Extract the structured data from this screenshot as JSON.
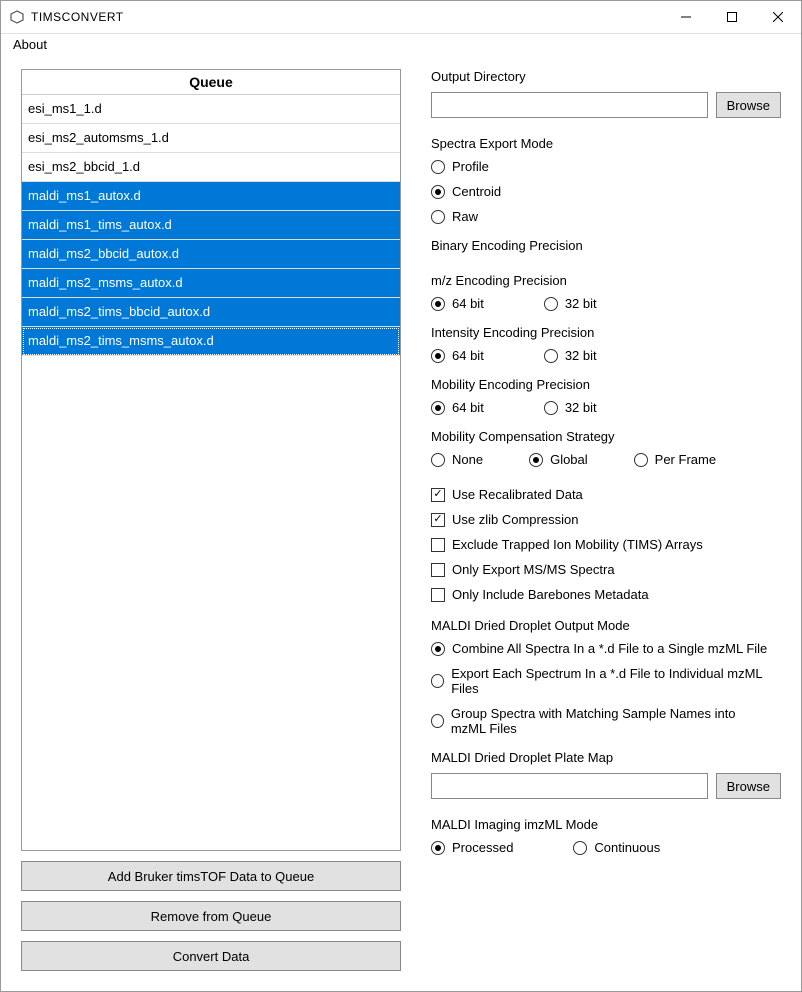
{
  "window": {
    "title": "TIMSCONVERT"
  },
  "menu": {
    "about": "About"
  },
  "queue": {
    "header": "Queue",
    "items": [
      {
        "label": "esi_ms1_1.d",
        "selected": false
      },
      {
        "label": "esi_ms2_automsms_1.d",
        "selected": false
      },
      {
        "label": "esi_ms2_bbcid_1.d",
        "selected": false
      },
      {
        "label": "maldi_ms1_autox.d",
        "selected": true
      },
      {
        "label": "maldi_ms1_tims_autox.d",
        "selected": true
      },
      {
        "label": "maldi_ms2_bbcid_autox.d",
        "selected": true
      },
      {
        "label": "maldi_ms2_msms_autox.d",
        "selected": true
      },
      {
        "label": "maldi_ms2_tims_bbcid_autox.d",
        "selected": true
      },
      {
        "label": "maldi_ms2_tims_msms_autox.d",
        "selected": true,
        "focus": true
      }
    ]
  },
  "buttons": {
    "add": "Add Bruker timsTOF Data to Queue",
    "remove": "Remove from Queue",
    "convert": "Convert Data",
    "browse": "Browse"
  },
  "labels": {
    "outputDir": "Output Directory",
    "spectraExport": "Spectra Export Mode",
    "profile": "Profile",
    "centroid": "Centroid",
    "raw": "Raw",
    "binaryPrecision": "Binary Encoding Precision",
    "mzPrecision": "m/z Encoding Precision",
    "intensityPrecision": "Intensity Encoding Precision",
    "mobilityPrecision": "Mobility Encoding Precision",
    "b64": "64 bit",
    "b32": "32 bit",
    "mobilityComp": "Mobility Compensation Strategy",
    "none": "None",
    "global": "Global",
    "perFrame": "Per Frame",
    "useRecal": "Use Recalibrated Data",
    "useZlib": "Use zlib Compression",
    "excludeTims": "Exclude Trapped Ion Mobility (TIMS) Arrays",
    "onlyMsms": "Only Export MS/MS Spectra",
    "onlyBarebones": "Only Include Barebones Metadata",
    "maldiOutput": "MALDI Dried Droplet Output Mode",
    "combine": "Combine All Spectra In a *.d File to a Single mzML File",
    "exportEach": "Export Each Spectrum In a *.d File to Individual mzML Files",
    "groupSpectra": "Group Spectra with Matching Sample Names into mzML Files",
    "plateMap": "MALDI Dried Droplet Plate Map",
    "imzmlMode": "MALDI Imaging imzML Mode",
    "processed": "Processed",
    "continuous": "Continuous"
  },
  "values": {
    "outputDir": "",
    "plateMap": ""
  }
}
